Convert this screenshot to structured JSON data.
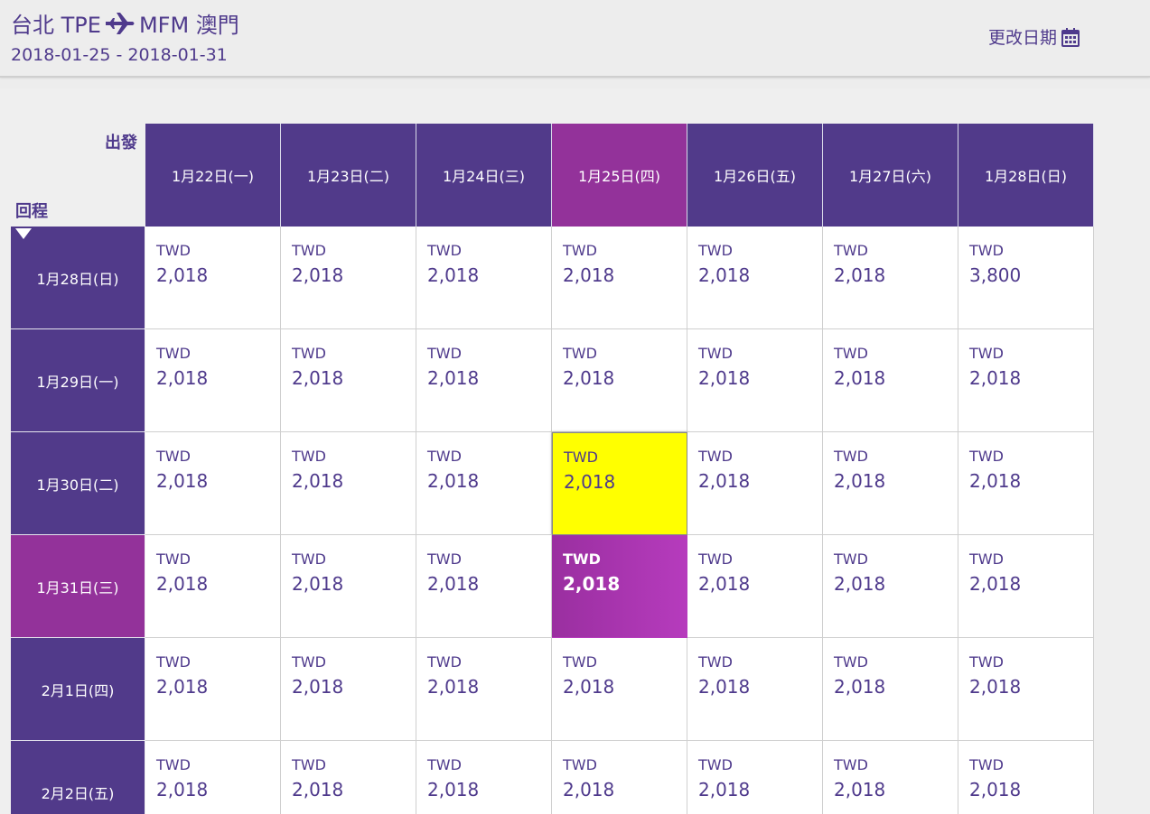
{
  "header": {
    "origin": "台北 TPE",
    "destination": "MFM 澳門",
    "date_range": "2018-01-25 - 2018-01-31",
    "change_date_label": "更改日期"
  },
  "grid": {
    "depart_label": "出發",
    "return_label": "回程",
    "depart_dates": [
      "1月22日(一)",
      "1月23日(二)",
      "1月24日(三)",
      "1月25日(四)",
      "1月26日(五)",
      "1月27日(六)",
      "1月28日(日)"
    ],
    "return_dates": [
      "1月28日(日)",
      "1月29日(一)",
      "1月30日(二)",
      "1月31日(三)",
      "2月1日(四)",
      "2月2日(五)"
    ],
    "currency": "TWD",
    "prices": [
      [
        "2,018",
        "2,018",
        "2,018",
        "2,018",
        "2,018",
        "2,018",
        "3,800"
      ],
      [
        "2,018",
        "2,018",
        "2,018",
        "2,018",
        "2,018",
        "2,018",
        "2,018"
      ],
      [
        "2,018",
        "2,018",
        "2,018",
        "2,018",
        "2,018",
        "2,018",
        "2,018"
      ],
      [
        "2,018",
        "2,018",
        "2,018",
        "2,018",
        "2,018",
        "2,018",
        "2,018"
      ],
      [
        "2,018",
        "2,018",
        "2,018",
        "2,018",
        "2,018",
        "2,018",
        "2,018"
      ],
      [
        "2,018",
        "2,018",
        "2,018",
        "2,018",
        "2,018",
        "2,018",
        "2,018"
      ]
    ],
    "selected_depart_index": 3,
    "selected_return_index": 3,
    "hover_cell": {
      "row": 2,
      "col": 3
    }
  },
  "colors": {
    "primary_purple": "#513a8a",
    "active_magenta": "#93329a",
    "hover_yellow": "#ffff00",
    "text_purple": "#4f3a8c"
  },
  "icons": {
    "plane": "airplane-icon",
    "calendar": "calendar-icon"
  }
}
